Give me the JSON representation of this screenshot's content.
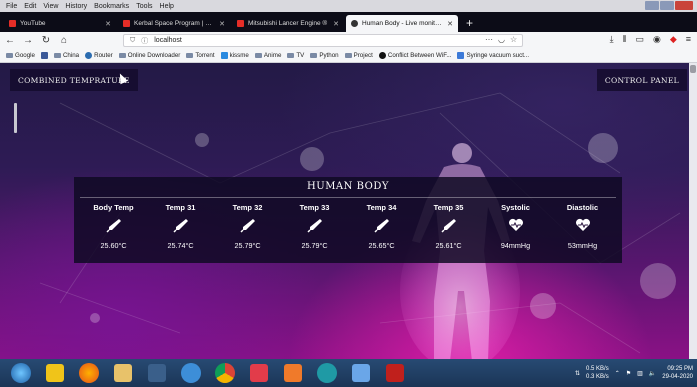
{
  "menu": [
    "File",
    "Edit",
    "View",
    "History",
    "Bookmarks",
    "Tools",
    "Help"
  ],
  "tabs": [
    {
      "label": "YouTube",
      "active": false
    },
    {
      "label": "Kerbal Space Program | World",
      "active": false
    },
    {
      "label": "Mitsubishi Lancer Engine ®",
      "active": false
    },
    {
      "label": "Human Body - Live monitoring",
      "active": true
    }
  ],
  "url": "localhost",
  "bookmarks": [
    "Google",
    "China",
    "Router",
    "Online Downloader",
    "Torrent",
    "kissme",
    "Anime",
    "TV",
    "Python",
    "Project",
    "Conflict Between WiF...",
    "Syringe vacuum suct..."
  ],
  "page": {
    "left_button": "COMBINED TEMPRATURE",
    "right_button": "CONTROL PANEL",
    "panel_title": "HUMAN BODY",
    "sensors": [
      {
        "label": "Body Temp",
        "value": "25.60°C",
        "icon": "thermometer-icon"
      },
      {
        "label": "Temp 31",
        "value": "25.74°C",
        "icon": "thermometer-icon"
      },
      {
        "label": "Temp 32",
        "value": "25.79°C",
        "icon": "thermometer-icon"
      },
      {
        "label": "Temp 33",
        "value": "25.79°C",
        "icon": "thermometer-icon"
      },
      {
        "label": "Temp 34",
        "value": "25.65°C",
        "icon": "thermometer-icon"
      },
      {
        "label": "Temp 35",
        "value": "25.61°C",
        "icon": "thermometer-icon"
      },
      {
        "label": "Systolic",
        "value": "94mmHg",
        "icon": "heart-pulse-icon"
      },
      {
        "label": "Diastolic",
        "value": "53mmHg",
        "icon": "heart-pulse-icon"
      }
    ]
  },
  "tray": {
    "net_up": "0.5 KB/s",
    "net_down": "0.3 KB/s",
    "time": "09:25 PM",
    "date": "29-04-2020"
  }
}
